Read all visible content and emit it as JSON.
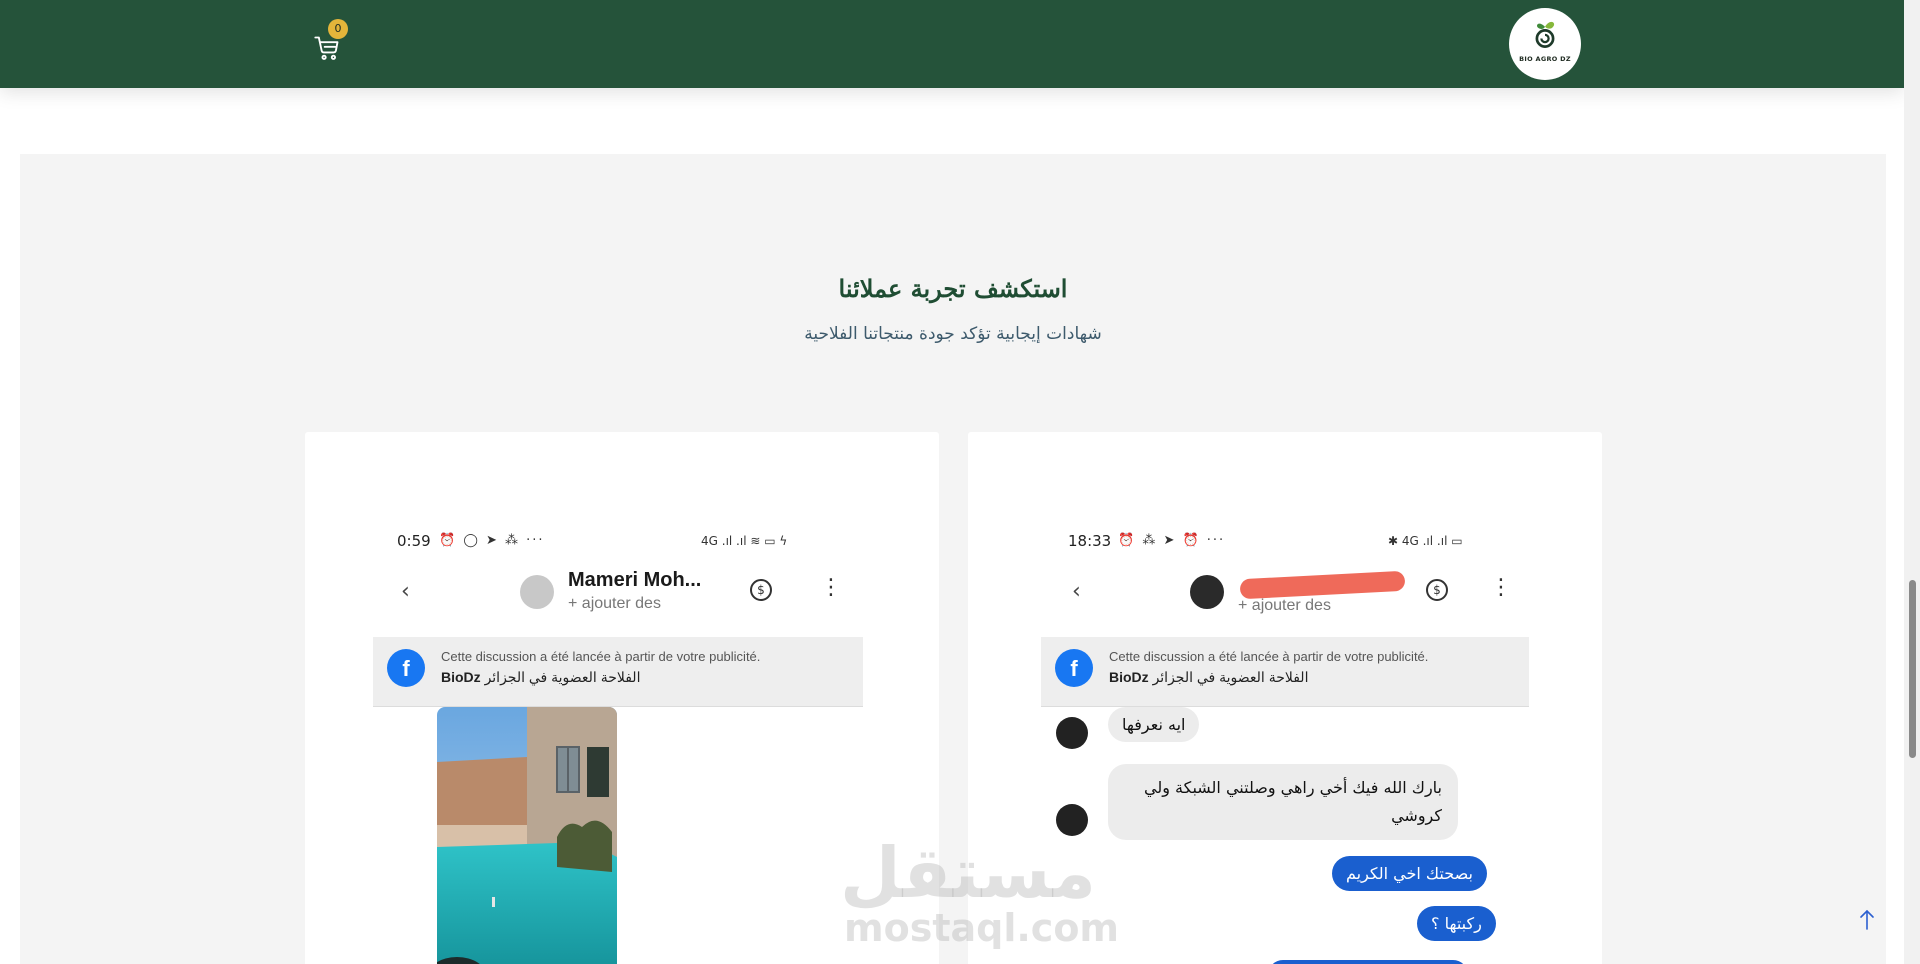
{
  "header": {
    "cart_count": "0",
    "logo_text": "BIO AGRO DZ",
    "bg_color": "#25533a",
    "badge_color": "#e4b53a"
  },
  "section": {
    "title": "استكشف تجربة عملائنا",
    "subtitle": "شهادات إيجابية تؤكد جودة منتجاتنا الفلاحية"
  },
  "testimonials": [
    {
      "status_time": "0:59",
      "contact_name": "Mameri Moh...",
      "contact_sub": "+ ajouter des",
      "banner_line1": "Cette discussion a été lancée à partir de votre publicité.",
      "banner_brand": "BioDz",
      "banner_page": "الفلاحة العضوية في الجزائر"
    },
    {
      "status_time": "18:33",
      "contact_sub": "+ ajouter des",
      "banner_line1": "Cette discussion a été lancée à partir de votre publicité.",
      "banner_brand": "BioDz",
      "banner_page": "الفلاحة العضوية في الجزائر",
      "messages": [
        {
          "from": "customer",
          "text": "ايه نعرفها"
        },
        {
          "from": "customer",
          "text": "بارك الله فيك أخي راهي وصلتني الشبكة ولي كروشي"
        },
        {
          "from": "store",
          "text": "بصحتك اخي الكريم"
        },
        {
          "from": "store",
          "text": "ركبتها ؟"
        }
      ]
    }
  ],
  "watermark": {
    "line1": "مستقل",
    "line2": "mostaql.com"
  }
}
